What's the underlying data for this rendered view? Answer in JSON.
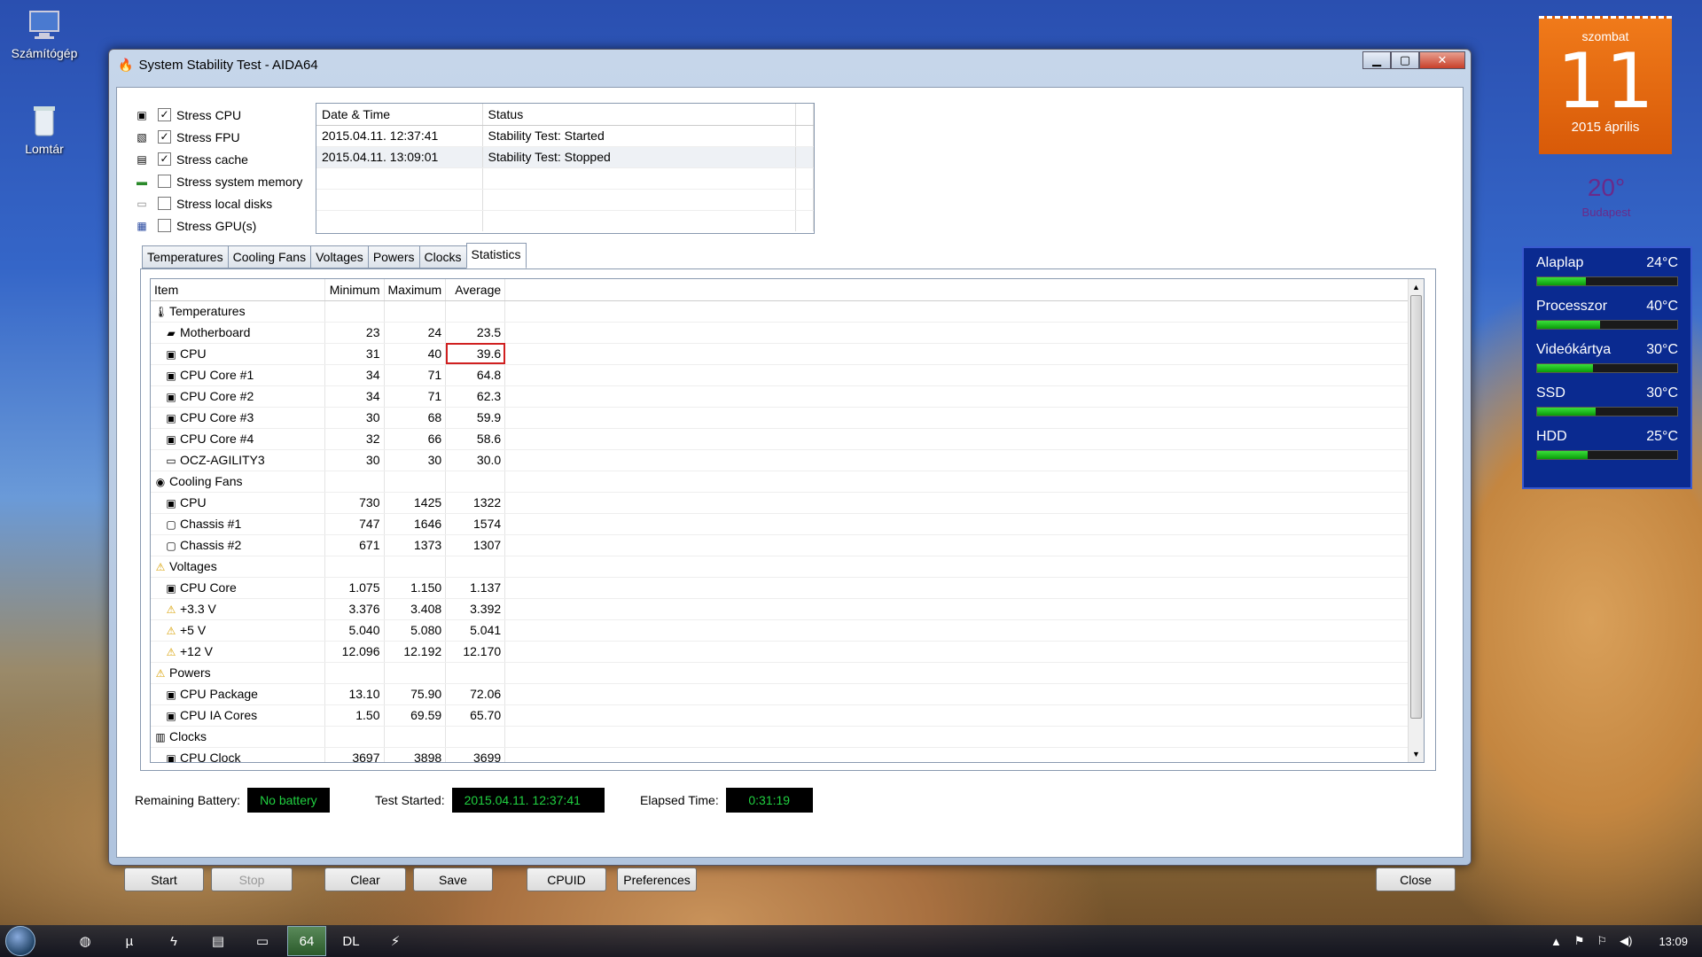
{
  "desktop": {
    "icons": [
      {
        "label": "Számítógép",
        "icon": "computer-icon"
      },
      {
        "label": "Lomtár",
        "icon": "recycle-bin-icon"
      }
    ]
  },
  "calendar": {
    "weekday": "szombat",
    "day": "11",
    "year_month": "2015 április"
  },
  "weather": {
    "temp": "20°",
    "city": "Budapest"
  },
  "sensors": [
    {
      "name": "Alaplap",
      "value": "24°C",
      "level": 0.35
    },
    {
      "name": "Processzor",
      "value": "40°C",
      "level": 0.45
    },
    {
      "name": "Videókártya",
      "value": "30°C",
      "level": 0.4
    },
    {
      "name": "SSD",
      "value": "30°C",
      "level": 0.42
    },
    {
      "name": "HDD",
      "value": "25°C",
      "level": 0.36
    }
  ],
  "window": {
    "title": "System Stability Test - AIDA64",
    "minimize": "▁",
    "maximize": "▢",
    "close": "✕"
  },
  "stress": [
    {
      "label": "Stress CPU",
      "checked": true,
      "icon": "cpu-icon"
    },
    {
      "label": "Stress FPU",
      "checked": true,
      "icon": "fpu-icon"
    },
    {
      "label": "Stress cache",
      "checked": true,
      "icon": "cache-icon"
    },
    {
      "label": "Stress system memory",
      "checked": false,
      "icon": "memory-icon"
    },
    {
      "label": "Stress local disks",
      "checked": false,
      "icon": "disk-icon"
    },
    {
      "label": "Stress GPU(s)",
      "checked": false,
      "icon": "gpu-icon"
    }
  ],
  "log": {
    "headers": [
      "Date & Time",
      "Status"
    ],
    "rows": [
      [
        "2015.04.11. 12:37:41",
        "Stability Test: Started"
      ],
      [
        "2015.04.11. 13:09:01",
        "Stability Test: Stopped"
      ]
    ]
  },
  "tabs": [
    "Temperatures",
    "Cooling Fans",
    "Voltages",
    "Powers",
    "Clocks",
    "Statistics"
  ],
  "active_tab": "Statistics",
  "stats": {
    "headers": [
      "Item",
      "Minimum",
      "Maximum",
      "Average"
    ],
    "rows": [
      {
        "item": "Temperatures",
        "group": true,
        "icon": "🌡",
        "min": "",
        "max": "",
        "avg": ""
      },
      {
        "item": "Motherboard",
        "icon": "▰",
        "min": "23",
        "max": "24",
        "avg": "23.5"
      },
      {
        "item": "CPU",
        "icon": "▣",
        "min": "31",
        "max": "40",
        "avg": "39.6",
        "highlight": true
      },
      {
        "item": "CPU Core #1",
        "icon": "▣",
        "min": "34",
        "max": "71",
        "avg": "64.8"
      },
      {
        "item": "CPU Core #2",
        "icon": "▣",
        "min": "34",
        "max": "71",
        "avg": "62.3"
      },
      {
        "item": "CPU Core #3",
        "icon": "▣",
        "min": "30",
        "max": "68",
        "avg": "59.9"
      },
      {
        "item": "CPU Core #4",
        "icon": "▣",
        "min": "32",
        "max": "66",
        "avg": "58.6"
      },
      {
        "item": "OCZ-AGILITY3",
        "icon": "▭",
        "min": "30",
        "max": "30",
        "avg": "30.0"
      },
      {
        "item": "Cooling Fans",
        "group": true,
        "icon": "◉",
        "min": "",
        "max": "",
        "avg": ""
      },
      {
        "item": "CPU",
        "icon": "▣",
        "min": "730",
        "max": "1425",
        "avg": "1322"
      },
      {
        "item": "Chassis #1",
        "icon": "▢",
        "min": "747",
        "max": "1646",
        "avg": "1574"
      },
      {
        "item": "Chassis #2",
        "icon": "▢",
        "min": "671",
        "max": "1373",
        "avg": "1307"
      },
      {
        "item": "Voltages",
        "group": true,
        "icon": "⚠",
        "min": "",
        "max": "",
        "avg": ""
      },
      {
        "item": "CPU Core",
        "icon": "▣",
        "min": "1.075",
        "max": "1.150",
        "avg": "1.137"
      },
      {
        "item": "+3.3 V",
        "icon": "⚠",
        "min": "3.376",
        "max": "3.408",
        "avg": "3.392"
      },
      {
        "item": "+5 V",
        "icon": "⚠",
        "min": "5.040",
        "max": "5.080",
        "avg": "5.041"
      },
      {
        "item": "+12 V",
        "icon": "⚠",
        "min": "12.096",
        "max": "12.192",
        "avg": "12.170"
      },
      {
        "item": "Powers",
        "group": true,
        "icon": "⚠",
        "min": "",
        "max": "",
        "avg": ""
      },
      {
        "item": "CPU Package",
        "icon": "▣",
        "min": "13.10",
        "max": "75.90",
        "avg": "72.06"
      },
      {
        "item": "CPU IA Cores",
        "icon": "▣",
        "min": "1.50",
        "max": "69.59",
        "avg": "65.70"
      },
      {
        "item": "Clocks",
        "group": true,
        "icon": "▥",
        "min": "",
        "max": "",
        "avg": ""
      },
      {
        "item": "CPU Clock",
        "icon": "▣",
        "min": "3697",
        "max": "3898",
        "avg": "3699"
      }
    ]
  },
  "status": {
    "battery_label": "Remaining Battery:",
    "battery_value": "No battery",
    "started_label": "Test Started:",
    "started_value": "2015.04.11. 12:37:41",
    "elapsed_label": "Elapsed Time:",
    "elapsed_value": "0:31:19"
  },
  "buttons": {
    "start": "Start",
    "stop": "Stop",
    "clear": "Clear",
    "save": "Save",
    "cpuid": "CPUID",
    "preferences": "Preferences",
    "close": "Close"
  },
  "taskbar": {
    "items": [
      {
        "icon": "chrome-icon",
        "glyph": "◍"
      },
      {
        "icon": "utorrent-icon",
        "glyph": "µ"
      },
      {
        "icon": "thunderbolt-icon",
        "glyph": "ϟ"
      },
      {
        "icon": "media-icon",
        "glyph": "▤"
      },
      {
        "icon": "folder-icon",
        "glyph": "▭"
      },
      {
        "icon": "aida64-icon",
        "glyph": "64",
        "active": true
      },
      {
        "icon": "daemon-tools-icon",
        "glyph": "DL"
      },
      {
        "icon": "tool-icon",
        "glyph": "⚡"
      }
    ],
    "clock": "13:09"
  }
}
